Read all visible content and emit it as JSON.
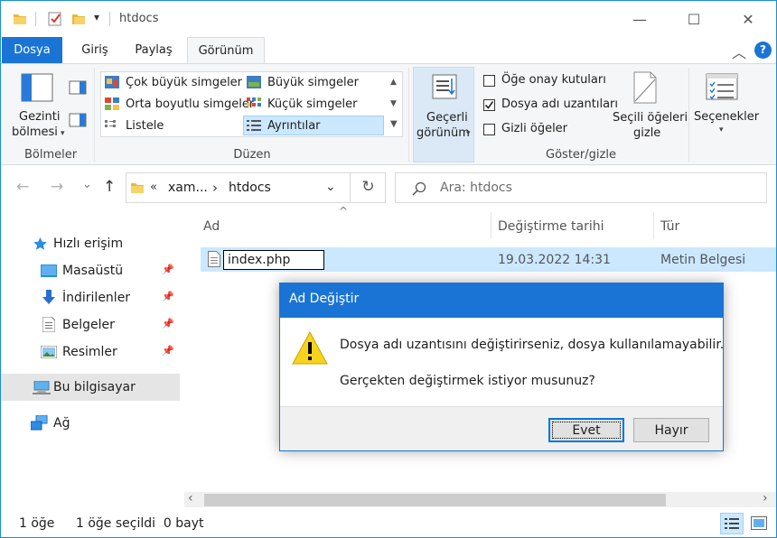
{
  "window": {
    "title": "htdocs",
    "minimize_glyph": "—",
    "maximize_glyph": "☐",
    "close_glyph": "✕"
  },
  "quick_access_toolbar": {
    "dropdown_glyph": "▾"
  },
  "ribbon_tabs": {
    "file": "Dosya",
    "home": "Giriş",
    "share": "Paylaş",
    "view": "Görünüm",
    "collapse_glyph": "︿",
    "help_glyph": "?"
  },
  "ribbon": {
    "panes": {
      "navigation_pane_line1": "Gezinti",
      "navigation_pane_line2": "bölmesi",
      "group_label": "Bölmeler"
    },
    "layout": {
      "group_label": "Düzen",
      "items": {
        "extra_large": "Çok büyük simgeler",
        "large": "Büyük simgeler",
        "medium": "Orta boyutlu simgeler",
        "small": "Küçük simgeler",
        "list": "Listele",
        "details": "Ayrıntılar"
      }
    },
    "current_view": {
      "line1": "Geçerli",
      "line2": "görünüm"
    },
    "show_hide": {
      "group_label": "Göster/gizle",
      "item_checkboxes": "Öğe onay kutuları",
      "file_name_extensions": "Dosya adı uzantıları",
      "hidden_items": "Gizli öğeler",
      "item_checkboxes_checked": false,
      "file_name_extensions_checked": true,
      "hidden_items_checked": false,
      "hide_selected_line1": "Seçili öğeleri",
      "hide_selected_line2": "gizle"
    },
    "options": {
      "label": "Seçenekler"
    }
  },
  "address_bar": {
    "back_glyph": "←",
    "forward_glyph": "→",
    "recent_glyph": "⌄",
    "up_glyph": "↑",
    "overflow": "«",
    "crumb1": "xam...",
    "crumb_sep": "›",
    "crumb2": "htdocs",
    "dropdown_glyph": "⌄",
    "refresh_glyph": "↻",
    "search_placeholder": "Ara: htdocs"
  },
  "navigation_pane": {
    "quick_access": "Hızlı erişim",
    "desktop": "Masaüstü",
    "downloads": "İndirilenler",
    "documents": "Belgeler",
    "pictures": "Resimler",
    "this_pc": "Bu bilgisayar",
    "network": "Ağ",
    "pin_glyph": "📌"
  },
  "file_list": {
    "columns": {
      "name": "Ad",
      "date_modified": "Değiştirme tarihi",
      "type": "Tür"
    },
    "sort_glyph": "^",
    "rows": [
      {
        "name": "index.php",
        "date_modified": "19.03.2022 14:31",
        "type": "Metin Belgesi"
      }
    ],
    "scroll_left_glyph": "‹",
    "scroll_right_glyph": "›"
  },
  "status_bar": {
    "item_count": "1 öğe",
    "selection": "1 öğe seçildi  0 bayt"
  },
  "dialog": {
    "title": "Ad Değiştir",
    "message1": "Dosya adı uzantısını değiştirirseniz, dosya kullanılamayabilir.",
    "message2": "Gerçekten değiştirmek istiyor musunuz?",
    "yes": "Evet",
    "no": "Hayır",
    "warning_glyph": "!"
  },
  "colors": {
    "accent": "#1a74d6",
    "selection": "#cce8ff",
    "ribbon_bg": "#f5f6f7",
    "warning_yellow": "#f8d21c"
  }
}
